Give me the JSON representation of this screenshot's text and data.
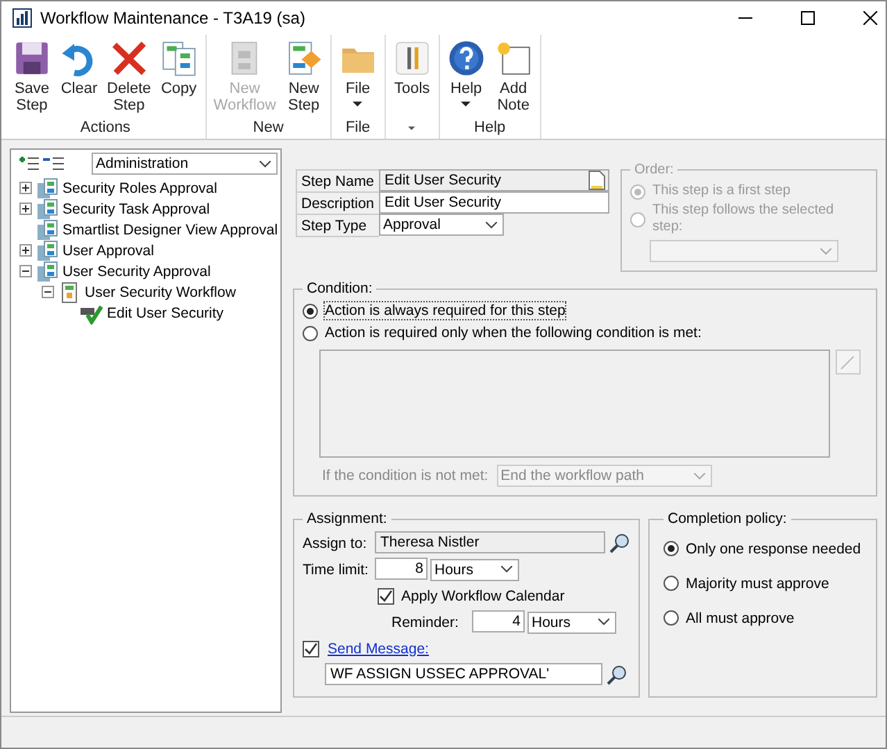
{
  "window": {
    "title": "Workflow Maintenance  -  T3A19 (sa)"
  },
  "ribbon": {
    "groups": [
      {
        "label": "Actions",
        "buttons": [
          {
            "label": "Save Step",
            "disabled": false
          },
          {
            "label": "Clear",
            "disabled": false
          },
          {
            "label": "Delete Step",
            "disabled": false
          },
          {
            "label": "Copy",
            "disabled": false
          }
        ]
      },
      {
        "label": "New",
        "buttons": [
          {
            "label": "New Workflow",
            "disabled": true
          },
          {
            "label": "New Step",
            "disabled": false
          }
        ]
      },
      {
        "label": "File",
        "buttons": [
          {
            "label": "File",
            "disabled": false,
            "dropdown": true
          }
        ]
      },
      {
        "menu": true,
        "buttons": [
          {
            "label": "Tools",
            "disabled": false
          }
        ]
      },
      {
        "label": "Help",
        "buttons": [
          {
            "label": "Help",
            "disabled": false,
            "dropdown": true
          },
          {
            "label": "Add Note",
            "disabled": false
          }
        ]
      }
    ]
  },
  "tree": {
    "filter": "Administration",
    "items": [
      {
        "label": "Security Roles Approval",
        "kind": "type",
        "expanded": false
      },
      {
        "label": "Security Task Approval",
        "kind": "type",
        "expanded": false
      },
      {
        "label": "Smartlist Designer View Approval",
        "kind": "type"
      },
      {
        "label": "User Approval",
        "kind": "type",
        "expanded": false
      },
      {
        "label": "User Security Approval",
        "kind": "type",
        "expanded": true,
        "children": [
          {
            "label": "User Security Workflow",
            "kind": "workflow",
            "expanded": true,
            "children": [
              {
                "label": "Edit User Security",
                "kind": "step"
              }
            ]
          }
        ]
      }
    ]
  },
  "step": {
    "name": {
      "label": "Step Name",
      "value": "Edit User Security"
    },
    "description": {
      "label": "Description",
      "value": "Edit User Security"
    },
    "type": {
      "label": "Step Type",
      "value": "Approval"
    }
  },
  "order": {
    "title": "Order:",
    "disabled": true,
    "options": [
      {
        "label": "This step is a first step",
        "selected": true
      },
      {
        "label": "This step follows the selected step:",
        "selected": false
      }
    ]
  },
  "condition": {
    "title": "Condition:",
    "options": [
      {
        "label": "Action is always required for this step",
        "selected": true
      },
      {
        "label": "Action is required only when the following condition is met:",
        "selected": false
      }
    ],
    "not_met": {
      "label": "If the condition is not met:",
      "value": "End the workflow path",
      "disabled": true
    }
  },
  "assignment": {
    "title": "Assignment:",
    "assign_to": {
      "label": "Assign to:",
      "value": "Theresa Nistler"
    },
    "time_limit": {
      "label": "Time limit:",
      "value": "8",
      "unit": "Hours"
    },
    "calendar": {
      "label": "Apply Workflow Calendar",
      "checked": true
    },
    "reminder": {
      "label": "Reminder:",
      "value": "4",
      "unit": "Hours"
    },
    "send_message": {
      "label": "Send Message:",
      "checked": true,
      "value": "WF ASSIGN USSEC APPROVAL'"
    }
  },
  "completion": {
    "title": "Completion policy:",
    "options": [
      {
        "label": "Only one response needed",
        "selected": true
      },
      {
        "label": "Majority must approve",
        "selected": false
      },
      {
        "label": "All must approve",
        "selected": false
      }
    ]
  }
}
